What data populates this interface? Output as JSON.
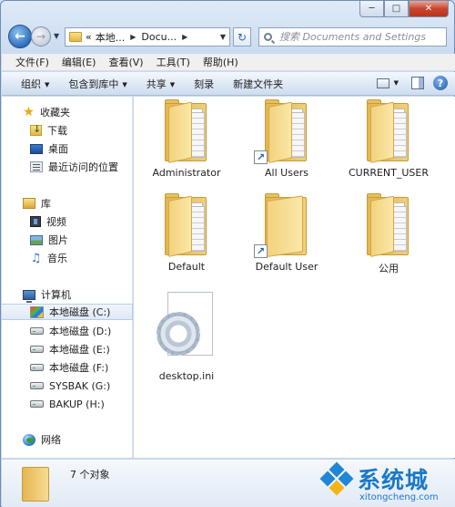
{
  "window": {
    "minimize_icon": "minimize-icon",
    "maximize_icon": "maximize-icon",
    "close_icon": "close-icon"
  },
  "address": {
    "back_icon": "back-arrow-icon",
    "forward_icon": "forward-arrow-icon",
    "prefix": "«",
    "crumbs": [
      "本地...",
      "Docu..."
    ],
    "refresh_icon": "refresh-icon"
  },
  "search": {
    "placeholder": "搜索 Documents and Settings"
  },
  "menu": [
    "文件(F)",
    "编辑(E)",
    "查看(V)",
    "工具(T)",
    "帮助(H)"
  ],
  "commands": {
    "organize": "组织",
    "include_library": "包含到库中",
    "share": "共享",
    "burn": "刻录",
    "new_folder": "新建文件夹",
    "help_glyph": "?"
  },
  "nav": {
    "favorites": "收藏夹",
    "downloads": "下载",
    "desktop": "桌面",
    "recent": "最近访问的位置",
    "libraries": "库",
    "videos": "视频",
    "pictures": "图片",
    "music": "音乐",
    "computer": "计算机",
    "drives": [
      "本地磁盘 (C:)",
      "本地磁盘 (D:)",
      "本地磁盘 (E:)",
      "本地磁盘 (F:)",
      "SYSBAK (G:)",
      "BAKUP (H:)"
    ],
    "network": "网络"
  },
  "items": [
    {
      "name": "Administrator",
      "type": "folder",
      "shortcut": false
    },
    {
      "name": "All Users",
      "type": "folder",
      "shortcut": true
    },
    {
      "name": "CURRENT_USER",
      "type": "folder",
      "shortcut": false
    },
    {
      "name": "Default",
      "type": "folder",
      "shortcut": false
    },
    {
      "name": "Default User",
      "type": "folder",
      "shortcut": true
    },
    {
      "name": "公用",
      "type": "folder",
      "shortcut": false
    },
    {
      "name": "desktop.ini",
      "type": "ini-file",
      "shortcut": false
    }
  ],
  "details": {
    "count": "7 个对象"
  },
  "watermark": {
    "brand": "系统城",
    "url": "xitongcheng.com"
  },
  "colors": {
    "accent": "#1a79c9",
    "selected_bg": "#dfe9f5",
    "folder": "#e4b651"
  }
}
